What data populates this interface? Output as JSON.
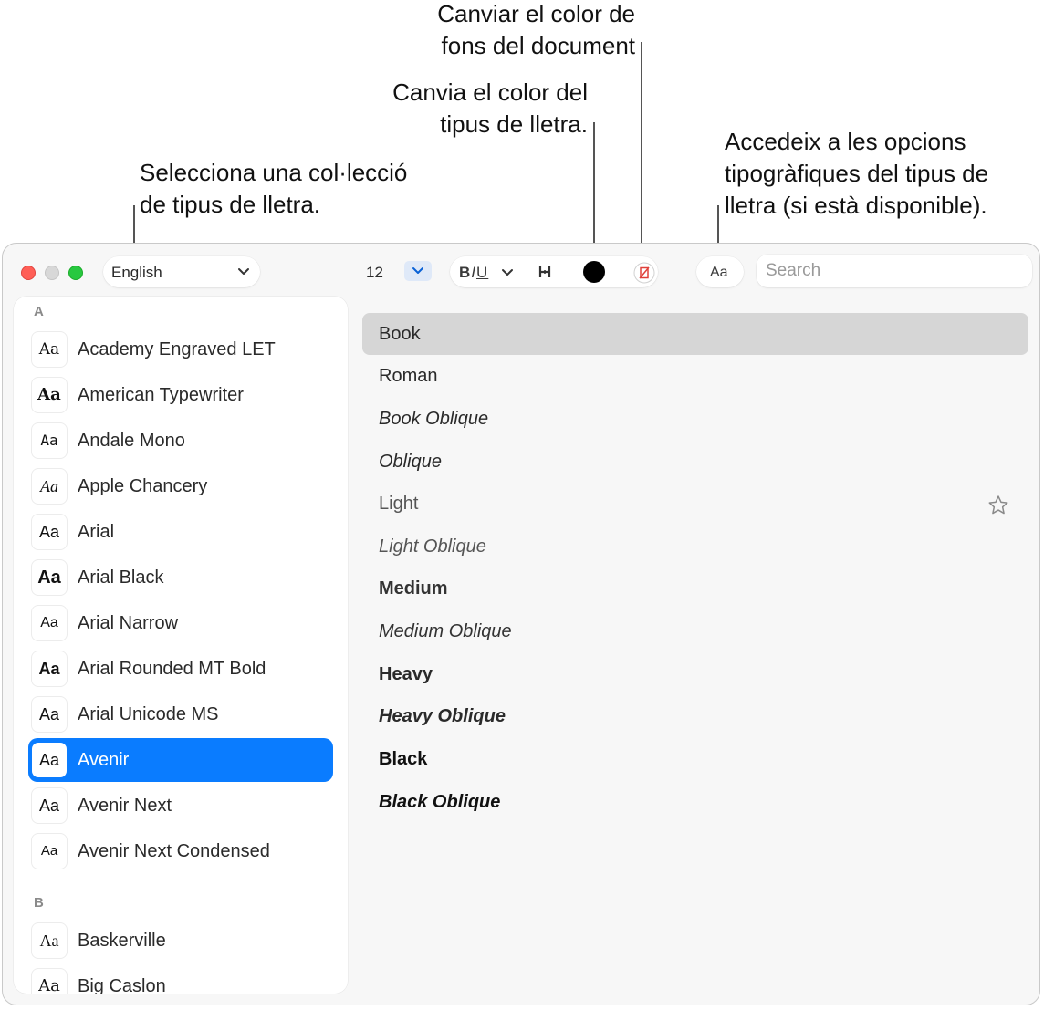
{
  "callouts": {
    "background_color": "Canviar el color de\nfons del document",
    "font_color": "Canvia el color del\ntipus de lletra.",
    "typography": "Accedeix a les opcions\ntipogràfiques del tipus de\nlletra (si està disponible).",
    "collection": "Selecciona una col·lecció\nde tipus de lletra."
  },
  "toolbar": {
    "collection_value": "English",
    "font_size": "12",
    "style_bold": "B",
    "style_italic": "I",
    "style_underline": "U",
    "font_color": "#000000",
    "typography_label": "Aa",
    "search_placeholder": "Search"
  },
  "families": {
    "sections": [
      {
        "letter": "A",
        "items": [
          {
            "sample": "Aa",
            "name": "Academy Engraved LET"
          },
          {
            "sample": "Aa",
            "name": "American Typewriter"
          },
          {
            "sample": "Aa",
            "name": "Andale Mono"
          },
          {
            "sample": "Aa",
            "name": "Apple Chancery"
          },
          {
            "sample": "Aa",
            "name": "Arial"
          },
          {
            "sample": "Aa",
            "name": "Arial Black"
          },
          {
            "sample": "Aa",
            "name": "Arial Narrow"
          },
          {
            "sample": "Aa",
            "name": "Arial Rounded MT Bold"
          },
          {
            "sample": "Aa",
            "name": "Arial Unicode MS"
          },
          {
            "sample": "Aa",
            "name": "Avenir",
            "selected": true
          },
          {
            "sample": "Aa",
            "name": "Avenir Next"
          },
          {
            "sample": "Aa",
            "name": "Avenir Next Condensed"
          }
        ]
      },
      {
        "letter": "B",
        "items": [
          {
            "sample": "Aa",
            "name": "Baskerville"
          },
          {
            "sample": "Aa",
            "name": "Big Caslon"
          }
        ]
      }
    ]
  },
  "typefaces": [
    {
      "name": "Book",
      "selected": true
    },
    {
      "name": "Roman"
    },
    {
      "name": "Book Oblique"
    },
    {
      "name": "Oblique"
    },
    {
      "name": "Light",
      "favorite_icon": "star-icon"
    },
    {
      "name": "Light Oblique"
    },
    {
      "name": "Medium"
    },
    {
      "name": "Medium Oblique"
    },
    {
      "name": "Heavy"
    },
    {
      "name": "Heavy Oblique"
    },
    {
      "name": "Black"
    },
    {
      "name": "Black Oblique"
    }
  ],
  "colors": {
    "selection": "#0a7cff",
    "typeface_selection": "#d6d6d6"
  }
}
